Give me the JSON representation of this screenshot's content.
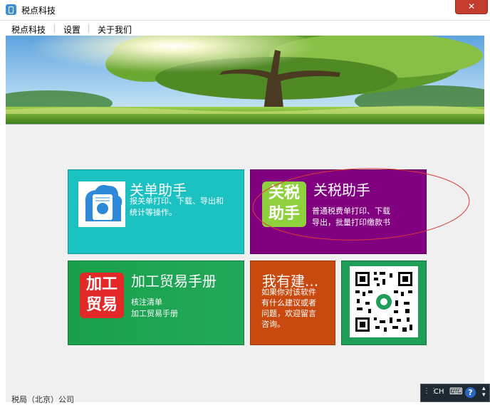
{
  "window": {
    "title": "税点科技",
    "close_label": "✕"
  },
  "menu": {
    "items": [
      {
        "label": "税点科技"
      },
      {
        "label": "设置"
      },
      {
        "label": "关于我们"
      }
    ]
  },
  "tiles": {
    "customs_assistant": {
      "title": "关单助手",
      "desc": [
        "报关单打印、下载、导出和",
        "统计等操作。"
      ],
      "color": "#1cc2c2"
    },
    "tax_assistant": {
      "title": "关税助手",
      "badge": [
        "关税",
        "助手"
      ],
      "desc": [
        "普通税费单打印、下载",
        "导出，批量打印缴款书"
      ],
      "color": "#800080",
      "badge_color": "#8fd13d"
    },
    "processing_trade": {
      "title": "加工贸易手册",
      "badge": [
        "加工",
        "贸易"
      ],
      "desc": [
        "核注清单",
        "加工贸易手册"
      ],
      "color": "#1fa14f",
      "badge_color": "#e32828"
    },
    "suggestion": {
      "title": "我有建...",
      "desc": [
        "如果你对该软件",
        "有什么建议或者",
        "问题，欢迎留言",
        "咨询。"
      ],
      "color": "#c94a0f"
    },
    "qrcode": {
      "color": "#1e9e57"
    }
  },
  "annotation": {
    "color": "#d93a3a"
  },
  "ime": {
    "lang": "CH"
  },
  "footer": {
    "company": "税局（北京）公司"
  }
}
